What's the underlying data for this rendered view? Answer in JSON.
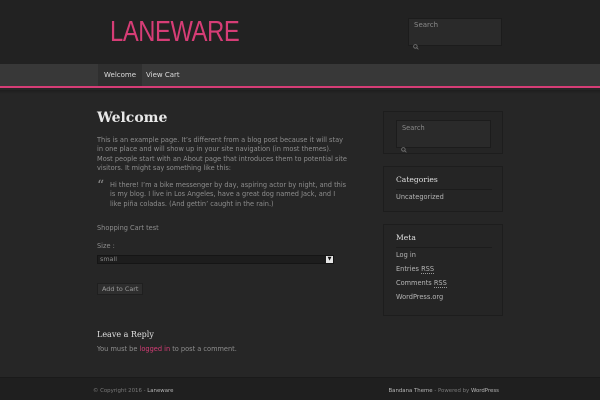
{
  "site": {
    "logo": "LANEWARE"
  },
  "header_search": {
    "placeholder": "Search"
  },
  "nav": {
    "items": [
      {
        "label": "Welcome"
      },
      {
        "label": "View Cart"
      }
    ]
  },
  "main": {
    "title": "Welcome",
    "intro": "This is an example page. It’s different from a blog post because it will stay in one place and will show up in your site navigation (in most themes). Most people start with an About page that introduces them to potential site visitors. It might say something like this:",
    "quote_mark": "“",
    "quote": "Hi there! I’m a bike messenger by day, aspiring actor by night, and this is my blog. I live in Los Angeles, have a great dog named Jack, and I like piña coladas. (And gettin’ caught in the rain.)",
    "cart_test": "Shopping Cart test",
    "size_label": "Size :",
    "size_value": "small",
    "add_button": "Add to Cart",
    "reply_title": "Leave a Reply",
    "reply_prefix": "You must be ",
    "reply_link": "logged in",
    "reply_suffix": " to post a comment."
  },
  "sidebar": {
    "search": {
      "placeholder": "Search"
    },
    "categories": {
      "title": "Categories",
      "items": [
        "Uncategorized"
      ]
    },
    "meta": {
      "title": "Meta",
      "log_in": "Log in",
      "entries_prefix": "Entries ",
      "entries_abbr": "RSS",
      "comments_prefix": "Comments ",
      "comments_abbr": "RSS",
      "wordpress": "WordPress.org"
    }
  },
  "footer": {
    "copyright": "© Copyright 2016 - ",
    "site_name": "Laneware",
    "theme": "Bandana Theme",
    "powered_prefix": " - Powered by ",
    "powered_by": "WordPress"
  },
  "icons": {
    "search": "search-icon"
  },
  "colors": {
    "accent": "#d63d76",
    "background": "#262626",
    "nav": "#383838"
  }
}
